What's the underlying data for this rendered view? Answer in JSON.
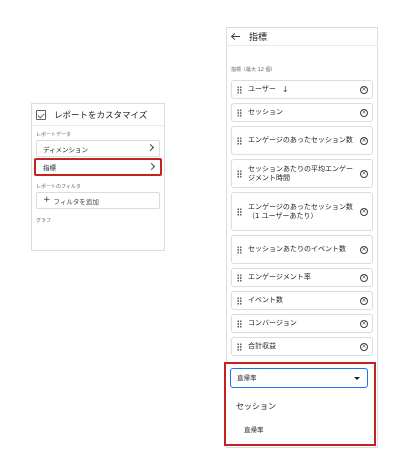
{
  "left_panel": {
    "title": "レポートをカスタマイズ",
    "section_report_data": "レポートデータ",
    "row_dimensions": "ディメンション",
    "row_metrics": "指標",
    "section_filter": "レポートのフィルタ",
    "add_filter": "フィルタを追加",
    "section_graph": "グラフ"
  },
  "right_panel": {
    "title": "指標",
    "section_label": "指標（最大 12 個）",
    "metrics": [
      {
        "label": "ユーザー"
      },
      {
        "label": "セッション"
      },
      {
        "label": "エンゲージのあったセッション数"
      },
      {
        "label": "セッションあたりの平均エンゲージメント時間"
      },
      {
        "label": "エンゲージのあったセッション数（1 ユーザーあたり）"
      },
      {
        "label": "セッションあたりのイベント数"
      },
      {
        "label": "エンゲージメント率"
      },
      {
        "label": "イベント数"
      },
      {
        "label": "コンバージョン"
      },
      {
        "label": "合計収益"
      }
    ],
    "dropdown": {
      "value": "直帰率",
      "group_label": "セッション",
      "option": "直帰率"
    }
  },
  "icons": {
    "customize": "customize-icon",
    "back": "back-arrow-icon",
    "drag": "drag-handle-icon",
    "remove": "close-circle-icon",
    "sort": "arrow-down-icon",
    "caret": "caret-down-icon"
  },
  "colors": {
    "highlight": "#c5221f",
    "focus": "#1a73e8"
  }
}
